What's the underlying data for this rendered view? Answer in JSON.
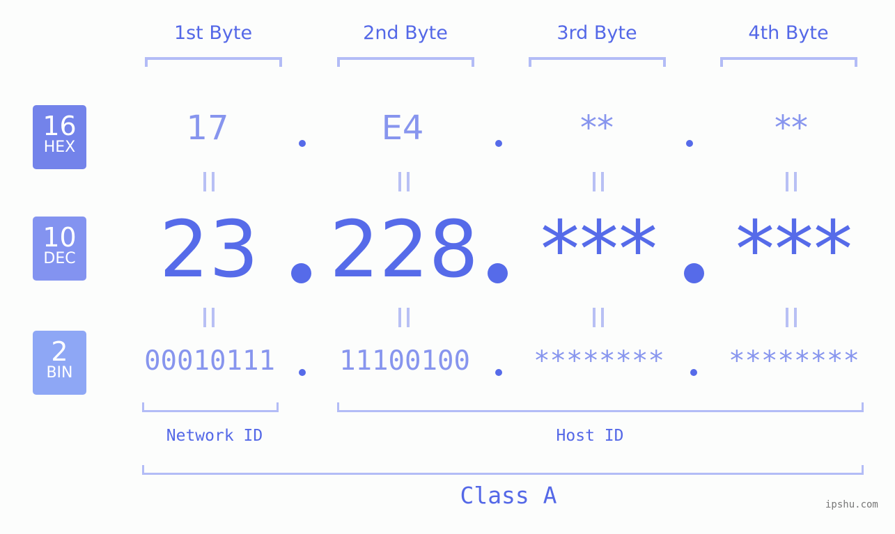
{
  "bytes": {
    "labels": [
      "1st Byte",
      "2nd Byte",
      "3rd Byte",
      "4th Byte"
    ]
  },
  "badges": {
    "hex": {
      "num": "16",
      "label": "HEX",
      "color": "#7383ea"
    },
    "dec": {
      "num": "10",
      "label": "DEC",
      "color": "#8393f0"
    },
    "bin": {
      "num": "2",
      "label": "BIN",
      "color": "#8ea7f5"
    }
  },
  "hex_values": [
    "17",
    "E4",
    "**",
    "**"
  ],
  "dec_values": [
    "23",
    "228",
    "***",
    "***"
  ],
  "bin_values": [
    "00010111",
    "11100100",
    "********",
    "********"
  ],
  "segments": {
    "network_id": "Network ID",
    "host_id": "Host ID",
    "class": "Class A"
  },
  "watermark": "ipshu.com",
  "colors": {
    "accent": "#566be9",
    "light": "#8795ee",
    "bracket": "#b3bcf6"
  }
}
